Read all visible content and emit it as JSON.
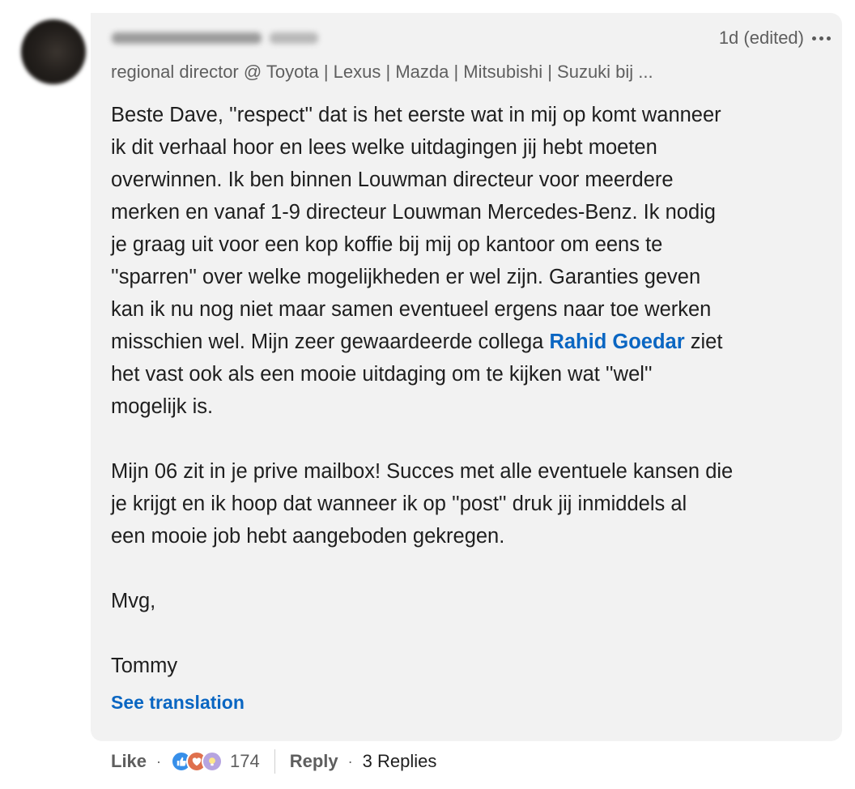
{
  "comment": {
    "timestamp": "1d (edited)",
    "headline": "regional director @ Toyota | Lexus | Mazda | Mitsubishi | Suzuki bij ...",
    "body": {
      "l1": "Beste Dave, ''respect'' dat is het eerste wat in mij op komt wanneer",
      "l2": "ik dit verhaal hoor en lees welke uitdagingen jij hebt moeten",
      "l3": "overwinnen. Ik ben binnen Louwman directeur voor meerdere",
      "l4": "merken en vanaf 1-9 directeur Louwman Mercedes-Benz. Ik nodig",
      "l5": "je graag uit voor een kop koffie bij mij op kantoor om eens te",
      "l6": "''sparren'' over welke mogelijkheden er wel zijn. Garanties geven",
      "l7": "kan ik nu nog niet maar samen eventueel ergens naar toe werken",
      "l8_before": "misschien wel. Mijn zeer gewaardeerde collega ",
      "mention": "Rahid Goedar",
      "l8_after": " ziet",
      "l9": "het vast ook als een mooie uitdaging om te kijken wat ''wel''",
      "l10": "mogelijk is.",
      "l11": "Mijn 06 zit in je prive mailbox! Succes met alle eventuele kansen die",
      "l12": "je krijgt en ik hoop dat wanneer ik op ''post'' druk jij inmiddels al",
      "l13": "een mooie job hebt aangeboden gekregen.",
      "l14": "Mvg,",
      "l15": "Tommy"
    },
    "see_translation": "See translation"
  },
  "actions": {
    "like": "Like",
    "separator": "·",
    "reaction_count": "174",
    "reply": "Reply",
    "replies": "3 Replies",
    "reaction_icons": [
      "like-icon",
      "love-icon",
      "insightful-icon"
    ]
  },
  "colors": {
    "link": "#0a66c2",
    "bubble": "#f2f2f2",
    "muted_text": "#5e5e5e"
  }
}
